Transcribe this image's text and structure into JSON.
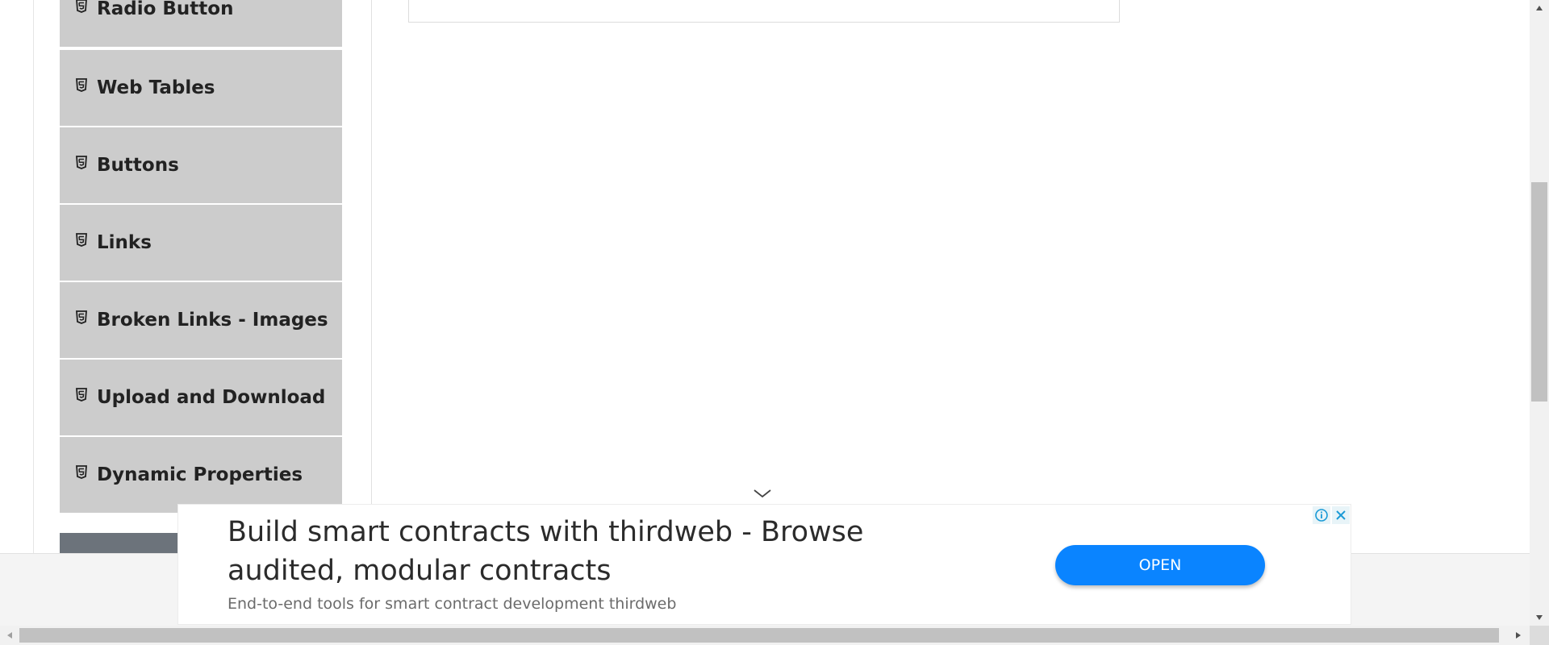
{
  "sidebar": {
    "items": [
      {
        "label": "Radio Button",
        "icon": "html5-icon"
      },
      {
        "label": "Web Tables",
        "icon": "html5-icon"
      },
      {
        "label": "Buttons",
        "icon": "html5-icon"
      },
      {
        "label": "Links",
        "icon": "html5-icon"
      },
      {
        "label": "Broken Links - Images",
        "icon": "html5-icon"
      },
      {
        "label": "Upload and Download",
        "icon": "html5-icon"
      },
      {
        "label": "Dynamic Properties",
        "icon": "html5-icon"
      }
    ]
  },
  "ad": {
    "headline": "Build smart contracts with thirdweb - Browse audited, modular contracts",
    "subtext": "End-to-end tools for smart contract development thirdweb",
    "button_label": "OPEN",
    "info_icon": "info-icon",
    "close_icon": "close-icon"
  },
  "colors": {
    "menu_bg": "#cccccc",
    "group_header_bg": "#6c737b",
    "ad_button": "#0a84ff",
    "footer_bg": "#f4f4f4"
  }
}
